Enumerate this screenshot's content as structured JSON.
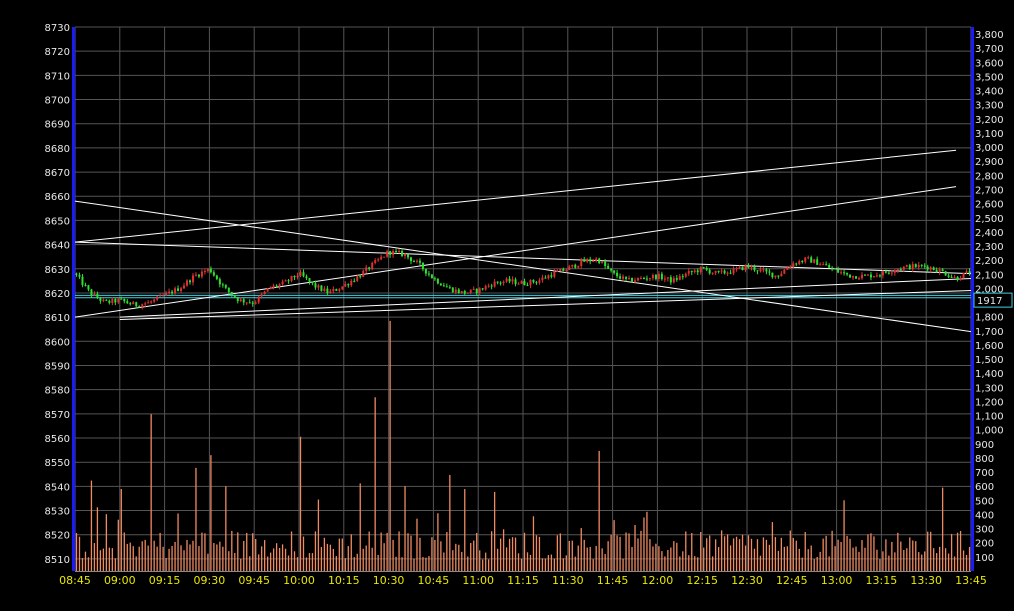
{
  "chart_data": {
    "type": "candlestick",
    "title": "",
    "grid": true,
    "colors": {
      "background": "#000000",
      "grid": "#555555",
      "axis_left": "#1a1aff",
      "axis_right": "#1a1aff",
      "up": "#e03030",
      "down": "#30e030",
      "volume": "#f08a60",
      "trendline": "#ffffff",
      "reference_line": "#40d0e0"
    },
    "price_axis": {
      "side": "left",
      "range": [
        8505,
        8730
      ],
      "ticks": [
        {
          "v": 8730,
          "label": "8730"
        },
        {
          "v": 8720,
          "label": "8720"
        },
        {
          "v": 8710,
          "label": "8710"
        },
        {
          "v": 8700,
          "label": "8700"
        },
        {
          "v": 8690,
          "label": "8690"
        },
        {
          "v": 8680,
          "label": "8680"
        },
        {
          "v": 8670,
          "label": "8670"
        },
        {
          "v": 8660,
          "label": "8660"
        },
        {
          "v": 8650,
          "label": "8650"
        },
        {
          "v": 8640,
          "label": "8640"
        },
        {
          "v": 8630,
          "label": "8630"
        },
        {
          "v": 8620,
          "label": "8620"
        },
        {
          "v": 8610,
          "label": "8610"
        },
        {
          "v": 8600,
          "label": "8600"
        },
        {
          "v": 8590,
          "label": "8590"
        },
        {
          "v": 8580,
          "label": "8580"
        },
        {
          "v": 8570,
          "label": "8570"
        },
        {
          "v": 8560,
          "label": "8560"
        },
        {
          "v": 8550,
          "label": "8550"
        },
        {
          "v": 8540,
          "label": "8540"
        },
        {
          "v": 8530,
          "label": "8530"
        },
        {
          "v": 8520,
          "label": "8520"
        },
        {
          "v": 8510,
          "label": "8510"
        }
      ]
    },
    "volume_axis": {
      "side": "right",
      "range": [
        0,
        3850
      ],
      "ticks": [
        {
          "v": 3800,
          "label": "3,800"
        },
        {
          "v": 3700,
          "label": "3,700"
        },
        {
          "v": 3600,
          "label": "3,600"
        },
        {
          "v": 3500,
          "label": "3,500"
        },
        {
          "v": 3400,
          "label": "3,400"
        },
        {
          "v": 3300,
          "label": "3,300"
        },
        {
          "v": 3200,
          "label": "3,200"
        },
        {
          "v": 3100,
          "label": "3,100"
        },
        {
          "v": 3000,
          "label": "3,000"
        },
        {
          "v": 2900,
          "label": "2,900"
        },
        {
          "v": 2800,
          "label": "2,800"
        },
        {
          "v": 2700,
          "label": "2,700"
        },
        {
          "v": 2600,
          "label": "2,600"
        },
        {
          "v": 2500,
          "label": "2,500"
        },
        {
          "v": 2400,
          "label": "2,400"
        },
        {
          "v": 2300,
          "label": "2,300"
        },
        {
          "v": 2200,
          "label": "2,200"
        },
        {
          "v": 2100,
          "label": "2,100"
        },
        {
          "v": 2000,
          "label": "2,000"
        },
        {
          "v": 1800,
          "label": "1,800"
        },
        {
          "v": 1700,
          "label": "1,700"
        },
        {
          "v": 1600,
          "label": "1,600"
        },
        {
          "v": 1500,
          "label": "1,500"
        },
        {
          "v": 1400,
          "label": "1,400"
        },
        {
          "v": 1300,
          "label": "1,300"
        },
        {
          "v": 1200,
          "label": "1,200"
        },
        {
          "v": 1100,
          "label": "1,100"
        },
        {
          "v": 1000,
          "label": "1,000"
        },
        {
          "v": 900,
          "label": "900"
        },
        {
          "v": 800,
          "label": "800"
        },
        {
          "v": 700,
          "label": "700"
        },
        {
          "v": 600,
          "label": "600"
        },
        {
          "v": 500,
          "label": "500"
        },
        {
          "v": 400,
          "label": "400"
        },
        {
          "v": 300,
          "label": "300"
        },
        {
          "v": 200,
          "label": "200"
        },
        {
          "v": 100,
          "label": "100"
        }
      ]
    },
    "reference_marker": {
      "v": 1917,
      "label": "1917"
    },
    "time_axis": {
      "range": [
        "08:45",
        "13:45"
      ],
      "ticks": [
        "08:45",
        "09:00",
        "09:15",
        "09:30",
        "09:45",
        "10:00",
        "10:15",
        "10:30",
        "10:45",
        "11:00",
        "11:15",
        "11:30",
        "11:45",
        "12:00",
        "12:15",
        "12:30",
        "12:45",
        "13:00",
        "13:15",
        "13:30",
        "13:45"
      ]
    },
    "reference_lines": [
      {
        "series": "price",
        "value": 8619
      },
      {
        "series": "price",
        "value": 8618
      }
    ],
    "trendlines": [
      {
        "from": [
          "08:45",
          8641
        ],
        "to": [
          "13:45",
          8628
        ]
      },
      {
        "from": [
          "08:45",
          8658
        ],
        "to": [
          "13:45",
          8604
        ]
      },
      {
        "from": [
          "08:45",
          8641
        ],
        "to": [
          "13:40",
          8679
        ]
      },
      {
        "from": [
          "08:45",
          8610
        ],
        "to": [
          "13:40",
          8664
        ]
      },
      {
        "from": [
          "09:00",
          8609
        ],
        "to": [
          "13:45",
          8621
        ]
      },
      {
        "from": [
          "09:00",
          8610
        ],
        "to": [
          "13:45",
          8626
        ]
      }
    ],
    "price_anchors": [
      [
        "08:45",
        8628
      ],
      [
        "08:50",
        8620
      ],
      [
        "08:55",
        8616
      ],
      [
        "09:00",
        8617
      ],
      [
        "09:05",
        8615
      ],
      [
        "09:10",
        8616
      ],
      [
        "09:15",
        8619
      ],
      [
        "09:20",
        8622
      ],
      [
        "09:25",
        8627
      ],
      [
        "09:30",
        8630
      ],
      [
        "09:35",
        8622
      ],
      [
        "09:40",
        8617
      ],
      [
        "09:45",
        8616
      ],
      [
        "09:50",
        8622
      ],
      [
        "09:55",
        8624
      ],
      [
        "10:00",
        8628
      ],
      [
        "10:05",
        8623
      ],
      [
        "10:10",
        8620
      ],
      [
        "10:15",
        8623
      ],
      [
        "10:20",
        8627
      ],
      [
        "10:25",
        8632
      ],
      [
        "10:30",
        8637
      ],
      [
        "10:35",
        8636
      ],
      [
        "10:40",
        8632
      ],
      [
        "10:45",
        8626
      ],
      [
        "10:50",
        8622
      ],
      [
        "10:55",
        8620
      ],
      [
        "11:00",
        8621
      ],
      [
        "11:05",
        8624
      ],
      [
        "11:10",
        8625
      ],
      [
        "11:15",
        8624
      ],
      [
        "11:20",
        8625
      ],
      [
        "11:25",
        8628
      ],
      [
        "11:30",
        8630
      ],
      [
        "11:35",
        8633
      ],
      [
        "11:40",
        8634
      ],
      [
        "11:45",
        8628
      ],
      [
        "11:50",
        8625
      ],
      [
        "11:55",
        8626
      ],
      [
        "12:00",
        8627
      ],
      [
        "12:05",
        8625
      ],
      [
        "12:10",
        8628
      ],
      [
        "12:15",
        8630
      ],
      [
        "12:20",
        8628
      ],
      [
        "12:25",
        8629
      ],
      [
        "12:30",
        8631
      ],
      [
        "12:35",
        8629
      ],
      [
        "12:40",
        8627
      ],
      [
        "12:45",
        8632
      ],
      [
        "12:50",
        8634
      ],
      [
        "12:55",
        8632
      ],
      [
        "13:00",
        8629
      ],
      [
        "13:05",
        8627
      ],
      [
        "13:10",
        8627
      ],
      [
        "13:15",
        8628
      ],
      [
        "13:20",
        8630
      ],
      [
        "13:25",
        8631
      ],
      [
        "13:30",
        8631
      ],
      [
        "13:35",
        8629
      ],
      [
        "13:40",
        8626
      ],
      [
        "13:45",
        8629
      ]
    ],
    "volume_spikes": [
      [
        "08:50",
        640
      ],
      [
        "09:00",
        580
      ],
      [
        "09:10",
        1110
      ],
      [
        "09:10",
        820
      ],
      [
        "09:25",
        730
      ],
      [
        "09:30",
        820
      ],
      [
        "09:35",
        600
      ],
      [
        "10:00",
        950
      ],
      [
        "10:20",
        620
      ],
      [
        "10:25",
        1230
      ],
      [
        "10:30",
        1770
      ],
      [
        "10:35",
        600
      ],
      [
        "10:50",
        680
      ],
      [
        "10:55",
        580
      ],
      [
        "11:05",
        560
      ],
      [
        "11:40",
        850
      ],
      [
        "11:45",
        360
      ],
      [
        "13:35",
        590
      ],
      [
        "13:45",
        600
      ]
    ],
    "volume_base": 230
  }
}
